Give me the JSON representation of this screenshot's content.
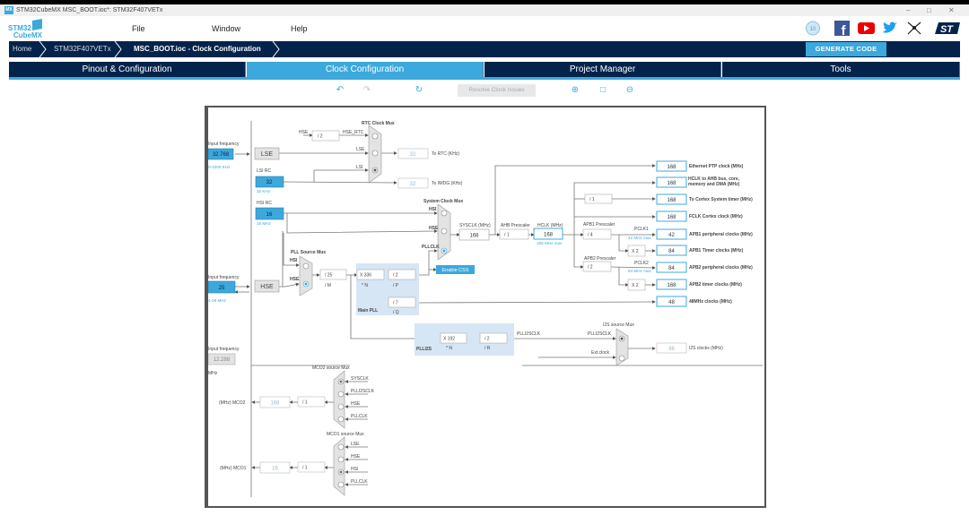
{
  "window": {
    "title": "STM32CubeMX MSC_BOOT.ioc*: STM32F407VETx",
    "app_icon": "MX",
    "controls": [
      "minimize-icon",
      "restore-icon",
      "close-icon"
    ]
  },
  "header": {
    "logo_line1": "STM32",
    "logo_line2": "CubeMX",
    "menu": [
      "File",
      "Window",
      "Help"
    ],
    "social_icons": [
      "anniversary-badge-icon",
      "facebook-icon",
      "youtube-icon",
      "twitter-icon",
      "network-icon",
      "st-logo-icon"
    ]
  },
  "breadcrumb": [
    "Home",
    "STM32F407VETx",
    "MSC_BOOT.ioc - Clock Configuration"
  ],
  "generate_code": "GENERATE CODE",
  "tabs": [
    {
      "label": "Pinout & Configuration",
      "active": false
    },
    {
      "label": "Clock Configuration",
      "active": true
    },
    {
      "label": "Project Manager",
      "active": false
    },
    {
      "label": "Tools",
      "active": false
    }
  ],
  "toolbar": {
    "resolve": "Resolve Clock Issues",
    "icons": [
      "undo-icon",
      "redo-icon",
      "refresh-icon",
      "zoom-in-icon",
      "fit-icon",
      "zoom-out-icon"
    ]
  },
  "colors": {
    "accent": "#3ca8dc",
    "navy": "#03234b",
    "pll_region": "#d6e6f5"
  },
  "diagram": {
    "lse": {
      "label": "Input frequency",
      "value": "32.768",
      "range": "0-1000 KHz",
      "name": "LSE"
    },
    "lsi": {
      "label": "LSI RC",
      "value": "32",
      "range": "32 KHz"
    },
    "hsi": {
      "label": "HSI RC",
      "value": "16",
      "range": "16 MHz"
    },
    "hse": {
      "label": "Input frequency",
      "value": "25",
      "range": "4-26 MHz",
      "name": "HSE"
    },
    "ext": {
      "label": "Input frequency",
      "value": "12.288",
      "unit": "MHz"
    },
    "rtc": {
      "title": "RTC Clock Mux",
      "hse": "HSE",
      "div": "/ 2",
      "hse_rtc": "HSE_RTC",
      "lse": "LSE",
      "lsi": "LSI",
      "rtc_value": "32",
      "rtc_label": "To RTC (KHz)",
      "iwdg_value": "32",
      "iwdg_label": "To IWDG (KHz)",
      "selected": "LSI"
    },
    "sysmux": {
      "title": "System Clock Mux",
      "hsi": "HSI",
      "hse": "HSE",
      "pllclk": "PLLCLK",
      "selected": "PLLCLK",
      "css": "Enable CSS"
    },
    "pllsrc": {
      "title": "PLL Source Mux",
      "hsi": "HSI",
      "hse": "HSE",
      "selected": "HSE"
    },
    "pll": {
      "title": "Main PLL",
      "m": "/ 25",
      "m_label": "/ M",
      "n": "X 336",
      "n_label": "* N",
      "p": "/ 2",
      "p_label": "/ P",
      "q": "/ 7",
      "q_label": "/ Q"
    },
    "sysclk": {
      "label": "SYSCLK (MHz)",
      "value": "168"
    },
    "ahb": {
      "label": "AHB Prescaler",
      "value": "/ 1"
    },
    "hclk": {
      "label": "HCLK (MHz)",
      "value": "168",
      "max": "168 MHz max"
    },
    "cortex_div": "/ 1",
    "apb1": {
      "label": "APB1 Prescaler",
      "value": "/ 4",
      "pclk": "PCLK1",
      "max": "42 MHz max",
      "x2": "X 2"
    },
    "apb2": {
      "label": "APB2 Prescaler",
      "value": "/ 2",
      "pclk": "PCLK2",
      "max": "84 MHz max",
      "x2": "X 2"
    },
    "outputs": [
      {
        "value": "168",
        "label": "Ethernet PTP clock (MHz)"
      },
      {
        "value": "168",
        "label": "HCLK to AHB bus, core, memory and DMA (MHz)"
      },
      {
        "value": "168",
        "label": "To Cortex System timer (MHz)"
      },
      {
        "value": "168",
        "label": "FCLK Cortex clock (MHz)"
      },
      {
        "value": "42",
        "label": "APB1 peripheral clocks (MHz)"
      },
      {
        "value": "84",
        "label": "APB1 Timer clocks (MHz)"
      },
      {
        "value": "84",
        "label": "APB2 peripheral clocks (MHz)"
      },
      {
        "value": "168",
        "label": "APB2 timer clocks (MHz)"
      },
      {
        "value": "48",
        "label": "48MHz clocks (MHz)"
      }
    ],
    "plli2s": {
      "title": "PLLI2S",
      "n": "X 192",
      "n_label": "* N",
      "r": "/ 2",
      "r_label": "/ R",
      "out": "PLLI2SCLK"
    },
    "i2s": {
      "title": "I2S source Mux",
      "in1": "PLLI2SCLK",
      "in2": "Ext.clock",
      "value": "96",
      "label": "I2S clocks (MHz)",
      "selected": "PLLI2SCLK"
    },
    "mco2": {
      "title": "MCO2 source Mux",
      "inputs": [
        "SYSCLK",
        "PLLI2SCLK",
        "HSE",
        "PLLCLK"
      ],
      "selected": "SYSCLK",
      "label": "(MHz) MCO2",
      "value": "168",
      "div": "/ 1"
    },
    "mco1": {
      "title": "MCO1 source Mux",
      "inputs": [
        "LSE",
        "HSE",
        "HSI",
        "PLLCLK"
      ],
      "selected": "HSI",
      "label": "(MHz) MCO1",
      "value": "16",
      "div": "/ 1"
    }
  }
}
